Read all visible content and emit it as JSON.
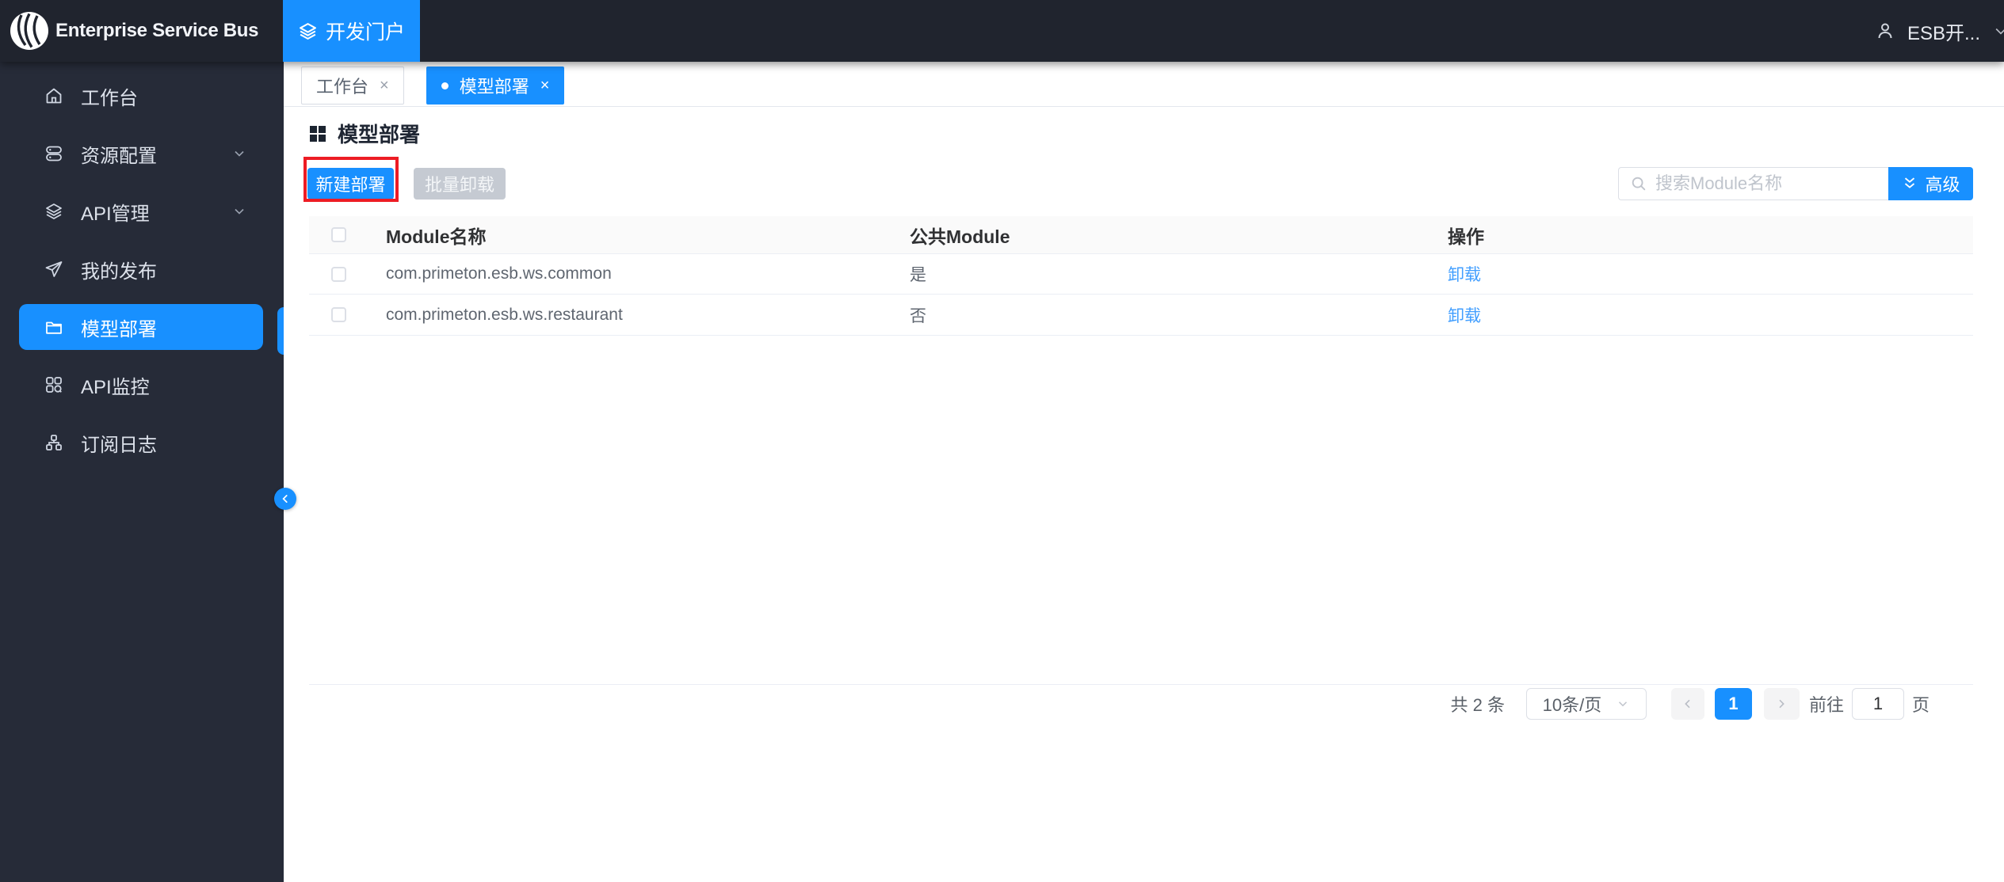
{
  "topbar": {
    "brand": "Enterprise Service Bus",
    "portal_label": "开发门户",
    "user_name": "ESB开..."
  },
  "sidebar": {
    "items": [
      {
        "label": "工作台",
        "icon": "home-icon",
        "expandable": false,
        "active": false
      },
      {
        "label": "资源配置",
        "icon": "resources-icon",
        "expandable": true,
        "active": false
      },
      {
        "label": "API管理",
        "icon": "layers-icon",
        "expandable": true,
        "active": false
      },
      {
        "label": "我的发布",
        "icon": "send-icon",
        "expandable": false,
        "active": false
      },
      {
        "label": "模型部署",
        "icon": "folder-icon",
        "expandable": false,
        "active": true
      },
      {
        "label": "API监控",
        "icon": "monitor-icon",
        "expandable": false,
        "active": false
      },
      {
        "label": "订阅日志",
        "icon": "share-icon",
        "expandable": false,
        "active": false
      }
    ]
  },
  "tabs": [
    {
      "label": "工作台",
      "active": false
    },
    {
      "label": "模型部署",
      "active": true
    }
  ],
  "ui": {
    "close_glyph": "×"
  },
  "page": {
    "title": "模型部署"
  },
  "toolbar": {
    "new_deploy_label": "新建部署",
    "batch_unload_label": "批量卸载",
    "search_placeholder": "搜索Module名称",
    "advanced_label": "高级"
  },
  "table": {
    "headers": {
      "module": "Module名称",
      "public": "公共Module",
      "action": "操作"
    },
    "rows": [
      {
        "module": "com.primeton.esb.ws.common",
        "public": "是",
        "action": "卸载"
      },
      {
        "module": "com.primeton.esb.ws.restaurant",
        "public": "否",
        "action": "卸载"
      }
    ]
  },
  "pagination": {
    "total_text": "共 2 条",
    "page_size": "10条/页",
    "current_page": "1",
    "goto_label": "前往",
    "goto_value": "1",
    "page_unit": "页"
  },
  "colors": {
    "accent_blue": "#1890ff",
    "link_blue": "#419eff",
    "annotation_red": "#ed1c24",
    "topbar_bg": "#20242e",
    "sidebar_bg": "#262b38",
    "disabled_btn": "#c5cad2",
    "table_header_bg": "#fafafa"
  }
}
